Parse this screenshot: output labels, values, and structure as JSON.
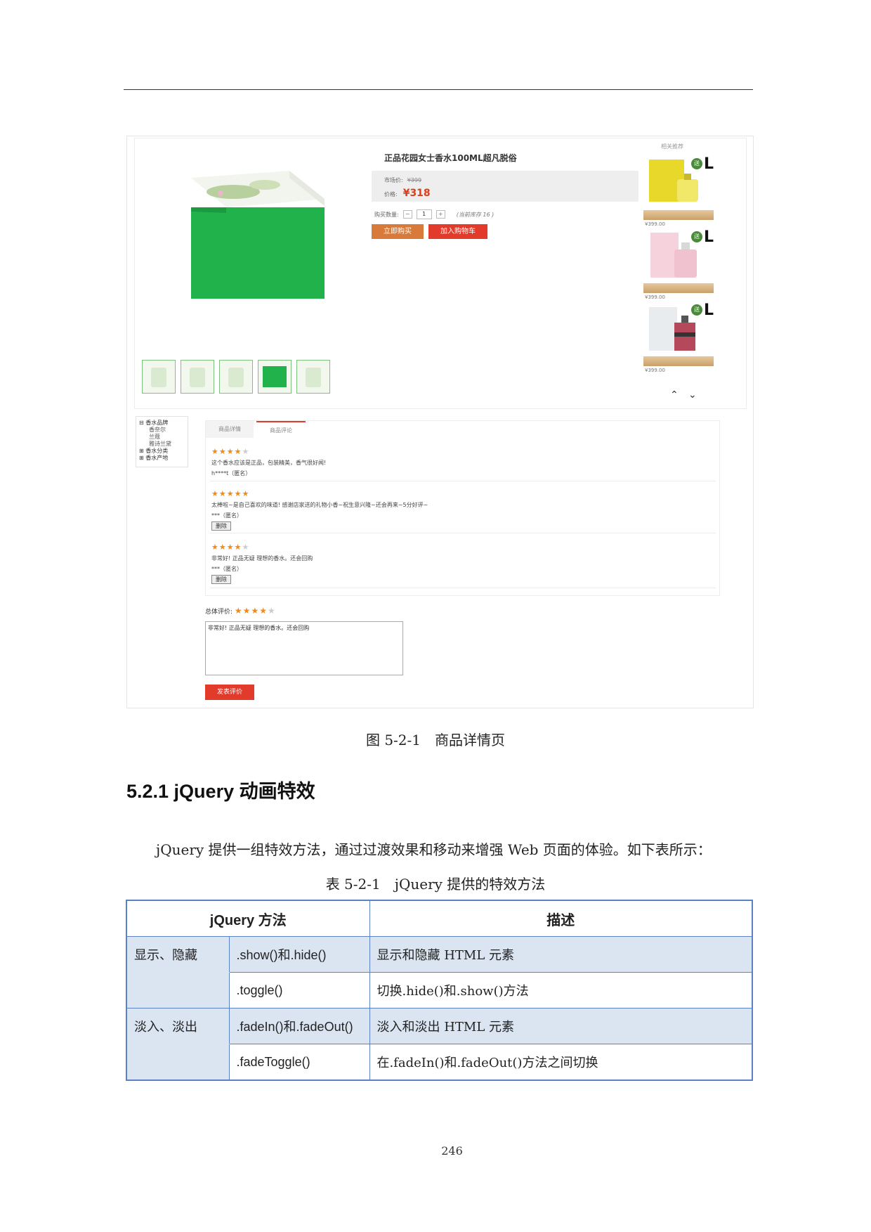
{
  "screenshot": {
    "product_title": "正品花园女士香水100ML超凡脱俗",
    "market_price_label": "市场价:",
    "market_price": "¥399",
    "price_label": "价格:",
    "price": "¥318",
    "quantity_label": "购买数量:",
    "quantity_minus": "−",
    "quantity_value": "1",
    "quantity_plus": "+",
    "stock_text": "(当前库存 16 )",
    "buy_now_label": "立即购买",
    "add_cart_label": "加入购物车",
    "related_title": "相关推荐",
    "related_items": [
      {
        "gift": "送",
        "size": "L",
        "price": "¥399.00"
      },
      {
        "gift": "送",
        "size": "L",
        "price": "¥399.00"
      },
      {
        "gift": "送",
        "size": "L",
        "price": "¥399.00"
      }
    ],
    "category_tree": {
      "brand": "香水品牌",
      "brand_children": [
        "香奈尔",
        "兰蔻",
        "雅诗兰黛"
      ],
      "category": "香水分类",
      "origin": "香水产地"
    },
    "tabs": [
      "商品详情",
      "商品评论"
    ],
    "reviews": [
      {
        "stars": "★★★★",
        "empty": "★",
        "text": "这个香水应该是正品，包装精美，香气很好闻!",
        "user": "h****t（匿名）",
        "delete": ""
      },
      {
        "stars": "★★★★★",
        "empty": "",
        "text": "太棒啦~是自己喜欢的味道! 感谢店家送的礼物小香~祝生意兴隆~还会再来~5分好评~",
        "user": "***（匿名）",
        "delete": "删除"
      },
      {
        "stars": "★★★★",
        "empty": "★",
        "text": "非常好! 正品无疑 理想的香水。还会回购",
        "user": "***（匿名）",
        "delete": "删除"
      }
    ],
    "overall_label": "总体评价:",
    "overall_stars": "★★★★",
    "overall_empty": "★",
    "comment_text": "非常好! 正品无疑 理想的香水。还会回购",
    "submit_label": "发表评价"
  },
  "figure_caption": "图 5-2-1　商品详情页",
  "section_title": "5.2.1 jQuery 动画特效",
  "paragraph": "jQuery 提供一组特效方法，通过过渡效果和移动来增强 Web 页面的体验。如下表所示：",
  "table_caption": "表 5-2-1　jQuery 提供的特效方法",
  "table": {
    "headers": [
      "jQuery 方法",
      "描述"
    ],
    "rows": [
      {
        "group": "显示、隐藏",
        "method": ".show()和.hide()",
        "desc": "显示和隐藏 HTML 元素"
      },
      {
        "group": "",
        "method": ".toggle()",
        "desc": "切换.hide()和.show()方法"
      },
      {
        "group": "淡入、淡出",
        "method": ".fadeIn()和.fadeOut()",
        "desc": "淡入和淡出 HTML 元素"
      },
      {
        "group": "",
        "method": ".fadeToggle()",
        "desc": "在.fadeIn()和.fadeOut()方法之间切换"
      }
    ]
  },
  "page_number": "246",
  "colors": {
    "price_red": "#e03c18",
    "button_red": "#e33b2b",
    "table_border": "#5b83c4",
    "table_shade": "#dbe5f1",
    "star_orange": "#f08a1d"
  }
}
